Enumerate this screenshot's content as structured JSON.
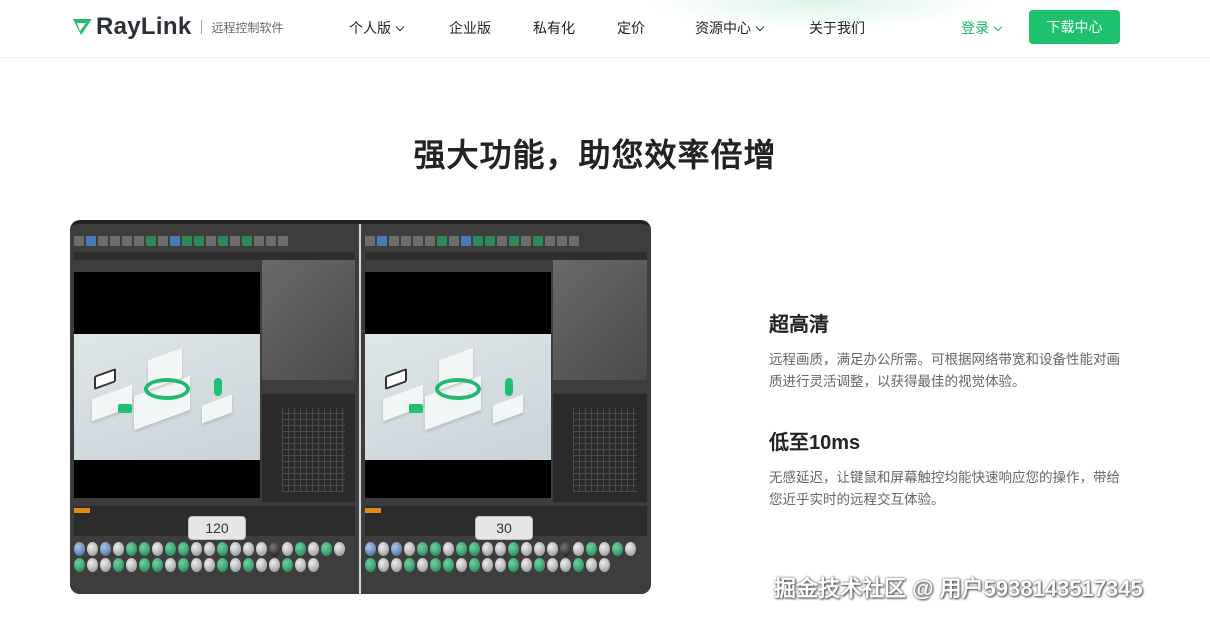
{
  "nav": {
    "logo_text": "RayLink",
    "logo_sub": "远程控制软件",
    "items": [
      {
        "label": "个人版",
        "has_dropdown": true
      },
      {
        "label": "企业版",
        "has_dropdown": false
      },
      {
        "label": "私有化",
        "has_dropdown": false
      },
      {
        "label": "定价",
        "has_dropdown": false
      },
      {
        "label": "资源中心",
        "has_dropdown": true
      },
      {
        "label": "关于我们",
        "has_dropdown": false
      }
    ],
    "login_label": "登录",
    "download_label": "下载中心"
  },
  "hero": {
    "heading": "强大功能，助您效率倍增"
  },
  "comparison": {
    "left_fps": "120",
    "right_fps": "30"
  },
  "features": [
    {
      "title": "超高清",
      "desc": "远程画质，满足办公所需。可根据网络带宽和设备性能对画质进行灵活调整，以获得最佳的视觉体验。"
    },
    {
      "title": "低至10ms",
      "desc": "无感延迟，让键鼠和屏幕触控均能快速响应您的操作，带给您近乎实时的远程交互体验。"
    }
  ],
  "watermark": "掘金技术社区 @ 用户5938143517345",
  "colors": {
    "brand_green": "#1ec16e",
    "login_green": "#19b36b"
  },
  "icons": {
    "logo": "raylink-logo-icon",
    "dropdown": "chevron-down-icon"
  }
}
